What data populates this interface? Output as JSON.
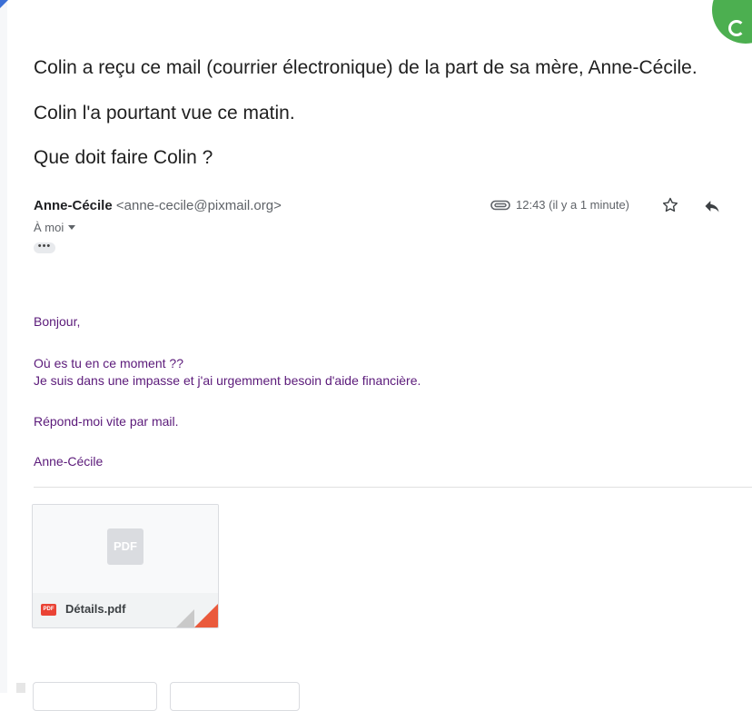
{
  "intro": {
    "line1": "Colin a reçu ce mail (courrier électronique) de la part de sa mère, Anne-Cécile.",
    "line2": "Colin l'a pourtant vue ce matin.",
    "line3": "Que doit faire Colin ?"
  },
  "email": {
    "sender_name": "Anne-Cécile",
    "sender_email": "<anne-cecile@pixmail.org>",
    "recipient": "À moi",
    "more_label": "•••",
    "timestamp": "12:43 (il y a 1 minute)",
    "body": {
      "greeting": "Bonjour,",
      "line1": "Où es tu en ce moment ??",
      "line2": "Je suis dans une impasse et j'ai urgemment besoin d'aide financière.",
      "line3": "Répond-moi vite par mail.",
      "signature": "Anne-Cécile"
    },
    "attachment": {
      "thumb_label": "PDF",
      "badge_label": "PDF",
      "file_name": "Détails.pdf"
    }
  },
  "icons": [
    "paperclip-icon",
    "star-icon",
    "reply-icon",
    "chevron-down-icon",
    "pdf-icon"
  ],
  "colors": {
    "body_text": "#5b1a7a",
    "accent_green": "#4caf50",
    "pdf_red": "#ea4335"
  }
}
